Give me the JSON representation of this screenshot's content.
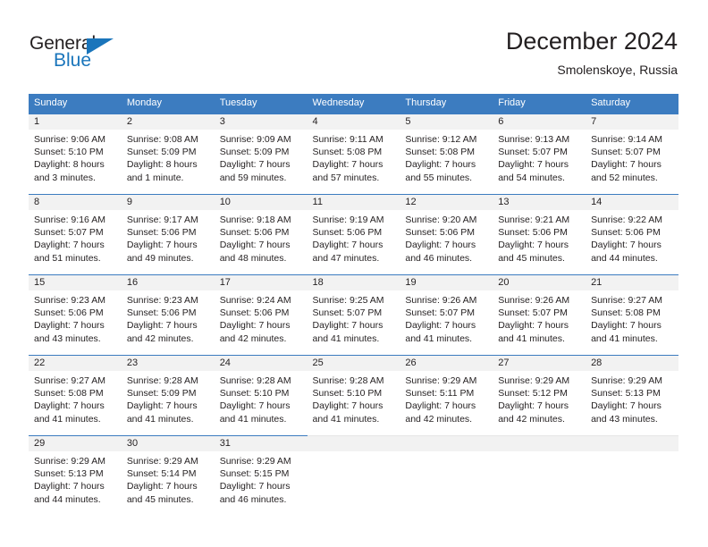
{
  "brand": {
    "name_top": "General",
    "name_bottom": "Blue",
    "accent_color": "#1a75bb"
  },
  "header": {
    "title": "December 2024",
    "subtitle": "Smolenskoye, Russia"
  },
  "calendar": {
    "header_color": "#3c7cc0",
    "weekday_headers": [
      "Sunday",
      "Monday",
      "Tuesday",
      "Wednesday",
      "Thursday",
      "Friday",
      "Saturday"
    ],
    "weeks": [
      [
        {
          "day": "1",
          "sunrise": "Sunrise: 9:06 AM",
          "sunset": "Sunset: 5:10 PM",
          "daylight_line1": "Daylight: 8 hours",
          "daylight_line2": "and 3 minutes."
        },
        {
          "day": "2",
          "sunrise": "Sunrise: 9:08 AM",
          "sunset": "Sunset: 5:09 PM",
          "daylight_line1": "Daylight: 8 hours",
          "daylight_line2": "and 1 minute."
        },
        {
          "day": "3",
          "sunrise": "Sunrise: 9:09 AM",
          "sunset": "Sunset: 5:09 PM",
          "daylight_line1": "Daylight: 7 hours",
          "daylight_line2": "and 59 minutes."
        },
        {
          "day": "4",
          "sunrise": "Sunrise: 9:11 AM",
          "sunset": "Sunset: 5:08 PM",
          "daylight_line1": "Daylight: 7 hours",
          "daylight_line2": "and 57 minutes."
        },
        {
          "day": "5",
          "sunrise": "Sunrise: 9:12 AM",
          "sunset": "Sunset: 5:08 PM",
          "daylight_line1": "Daylight: 7 hours",
          "daylight_line2": "and 55 minutes."
        },
        {
          "day": "6",
          "sunrise": "Sunrise: 9:13 AM",
          "sunset": "Sunset: 5:07 PM",
          "daylight_line1": "Daylight: 7 hours",
          "daylight_line2": "and 54 minutes."
        },
        {
          "day": "7",
          "sunrise": "Sunrise: 9:14 AM",
          "sunset": "Sunset: 5:07 PM",
          "daylight_line1": "Daylight: 7 hours",
          "daylight_line2": "and 52 minutes."
        }
      ],
      [
        {
          "day": "8",
          "sunrise": "Sunrise: 9:16 AM",
          "sunset": "Sunset: 5:07 PM",
          "daylight_line1": "Daylight: 7 hours",
          "daylight_line2": "and 51 minutes."
        },
        {
          "day": "9",
          "sunrise": "Sunrise: 9:17 AM",
          "sunset": "Sunset: 5:06 PM",
          "daylight_line1": "Daylight: 7 hours",
          "daylight_line2": "and 49 minutes."
        },
        {
          "day": "10",
          "sunrise": "Sunrise: 9:18 AM",
          "sunset": "Sunset: 5:06 PM",
          "daylight_line1": "Daylight: 7 hours",
          "daylight_line2": "and 48 minutes."
        },
        {
          "day": "11",
          "sunrise": "Sunrise: 9:19 AM",
          "sunset": "Sunset: 5:06 PM",
          "daylight_line1": "Daylight: 7 hours",
          "daylight_line2": "and 47 minutes."
        },
        {
          "day": "12",
          "sunrise": "Sunrise: 9:20 AM",
          "sunset": "Sunset: 5:06 PM",
          "daylight_line1": "Daylight: 7 hours",
          "daylight_line2": "and 46 minutes."
        },
        {
          "day": "13",
          "sunrise": "Sunrise: 9:21 AM",
          "sunset": "Sunset: 5:06 PM",
          "daylight_line1": "Daylight: 7 hours",
          "daylight_line2": "and 45 minutes."
        },
        {
          "day": "14",
          "sunrise": "Sunrise: 9:22 AM",
          "sunset": "Sunset: 5:06 PM",
          "daylight_line1": "Daylight: 7 hours",
          "daylight_line2": "and 44 minutes."
        }
      ],
      [
        {
          "day": "15",
          "sunrise": "Sunrise: 9:23 AM",
          "sunset": "Sunset: 5:06 PM",
          "daylight_line1": "Daylight: 7 hours",
          "daylight_line2": "and 43 minutes."
        },
        {
          "day": "16",
          "sunrise": "Sunrise: 9:23 AM",
          "sunset": "Sunset: 5:06 PM",
          "daylight_line1": "Daylight: 7 hours",
          "daylight_line2": "and 42 minutes."
        },
        {
          "day": "17",
          "sunrise": "Sunrise: 9:24 AM",
          "sunset": "Sunset: 5:06 PM",
          "daylight_line1": "Daylight: 7 hours",
          "daylight_line2": "and 42 minutes."
        },
        {
          "day": "18",
          "sunrise": "Sunrise: 9:25 AM",
          "sunset": "Sunset: 5:07 PM",
          "daylight_line1": "Daylight: 7 hours",
          "daylight_line2": "and 41 minutes."
        },
        {
          "day": "19",
          "sunrise": "Sunrise: 9:26 AM",
          "sunset": "Sunset: 5:07 PM",
          "daylight_line1": "Daylight: 7 hours",
          "daylight_line2": "and 41 minutes."
        },
        {
          "day": "20",
          "sunrise": "Sunrise: 9:26 AM",
          "sunset": "Sunset: 5:07 PM",
          "daylight_line1": "Daylight: 7 hours",
          "daylight_line2": "and 41 minutes."
        },
        {
          "day": "21",
          "sunrise": "Sunrise: 9:27 AM",
          "sunset": "Sunset: 5:08 PM",
          "daylight_line1": "Daylight: 7 hours",
          "daylight_line2": "and 41 minutes."
        }
      ],
      [
        {
          "day": "22",
          "sunrise": "Sunrise: 9:27 AM",
          "sunset": "Sunset: 5:08 PM",
          "daylight_line1": "Daylight: 7 hours",
          "daylight_line2": "and 41 minutes."
        },
        {
          "day": "23",
          "sunrise": "Sunrise: 9:28 AM",
          "sunset": "Sunset: 5:09 PM",
          "daylight_line1": "Daylight: 7 hours",
          "daylight_line2": "and 41 minutes."
        },
        {
          "day": "24",
          "sunrise": "Sunrise: 9:28 AM",
          "sunset": "Sunset: 5:10 PM",
          "daylight_line1": "Daylight: 7 hours",
          "daylight_line2": "and 41 minutes."
        },
        {
          "day": "25",
          "sunrise": "Sunrise: 9:28 AM",
          "sunset": "Sunset: 5:10 PM",
          "daylight_line1": "Daylight: 7 hours",
          "daylight_line2": "and 41 minutes."
        },
        {
          "day": "26",
          "sunrise": "Sunrise: 9:29 AM",
          "sunset": "Sunset: 5:11 PM",
          "daylight_line1": "Daylight: 7 hours",
          "daylight_line2": "and 42 minutes."
        },
        {
          "day": "27",
          "sunrise": "Sunrise: 9:29 AM",
          "sunset": "Sunset: 5:12 PM",
          "daylight_line1": "Daylight: 7 hours",
          "daylight_line2": "and 42 minutes."
        },
        {
          "day": "28",
          "sunrise": "Sunrise: 9:29 AM",
          "sunset": "Sunset: 5:13 PM",
          "daylight_line1": "Daylight: 7 hours",
          "daylight_line2": "and 43 minutes."
        }
      ],
      [
        {
          "day": "29",
          "sunrise": "Sunrise: 9:29 AM",
          "sunset": "Sunset: 5:13 PM",
          "daylight_line1": "Daylight: 7 hours",
          "daylight_line2": "and 44 minutes."
        },
        {
          "day": "30",
          "sunrise": "Sunrise: 9:29 AM",
          "sunset": "Sunset: 5:14 PM",
          "daylight_line1": "Daylight: 7 hours",
          "daylight_line2": "and 45 minutes."
        },
        {
          "day": "31",
          "sunrise": "Sunrise: 9:29 AM",
          "sunset": "Sunset: 5:15 PM",
          "daylight_line1": "Daylight: 7 hours",
          "daylight_line2": "and 46 minutes."
        },
        {
          "day": "",
          "sunrise": "",
          "sunset": "",
          "daylight_line1": "",
          "daylight_line2": ""
        },
        {
          "day": "",
          "sunrise": "",
          "sunset": "",
          "daylight_line1": "",
          "daylight_line2": ""
        },
        {
          "day": "",
          "sunrise": "",
          "sunset": "",
          "daylight_line1": "",
          "daylight_line2": ""
        },
        {
          "day": "",
          "sunrise": "",
          "sunset": "",
          "daylight_line1": "",
          "daylight_line2": ""
        }
      ]
    ]
  }
}
